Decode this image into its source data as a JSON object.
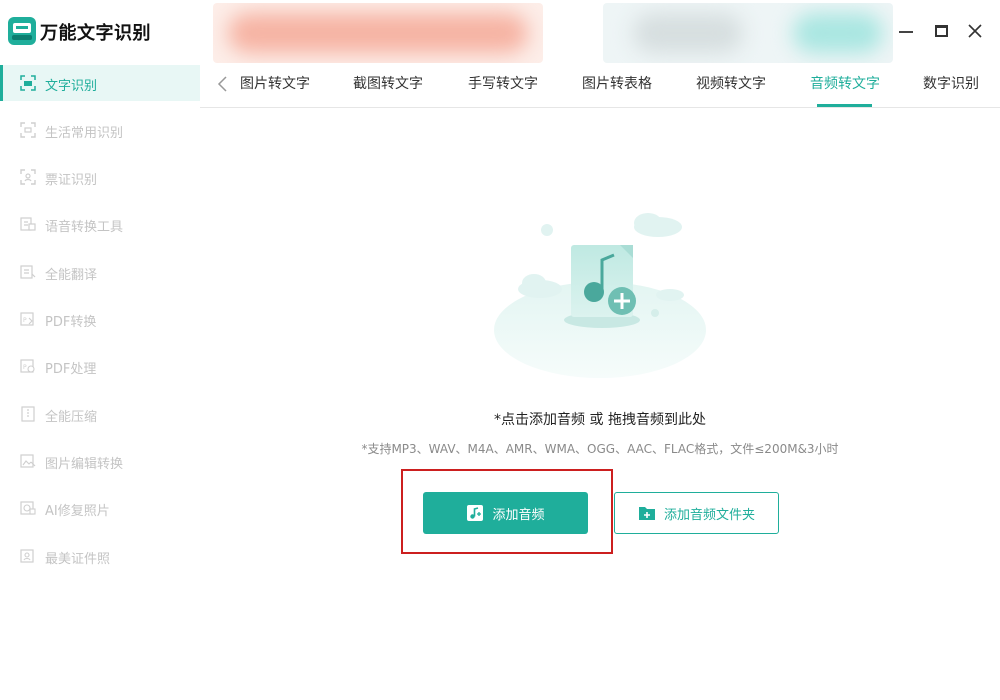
{
  "app": {
    "title": "万能文字识别"
  },
  "window": {
    "min_icon": "minimize-icon",
    "max_icon": "maximize-icon",
    "close_icon": "close-icon"
  },
  "sidebar": {
    "items": [
      {
        "label": "文字识别",
        "icon": "text-scan-icon",
        "active": true
      },
      {
        "label": "生活常用识别",
        "icon": "scan-frame-icon"
      },
      {
        "label": "票证识别",
        "icon": "id-scan-icon"
      },
      {
        "label": "语音转换工具",
        "icon": "voice-convert-icon"
      },
      {
        "label": "全能翻译",
        "icon": "translate-icon"
      },
      {
        "label": "PDF转换",
        "icon": "pdf-convert-icon"
      },
      {
        "label": "PDF处理",
        "icon": "pdf-process-icon"
      },
      {
        "label": "全能压缩",
        "icon": "compress-icon"
      },
      {
        "label": "图片编辑转换",
        "icon": "image-edit-icon"
      },
      {
        "label": "AI修复照片",
        "icon": "ai-photo-icon"
      },
      {
        "label": "最美证件照",
        "icon": "id-photo-icon"
      }
    ]
  },
  "tabs": {
    "back_icon": "chevron-left-icon",
    "items": [
      {
        "label": "图片转文字"
      },
      {
        "label": "截图转文字"
      },
      {
        "label": "手写转文字"
      },
      {
        "label": "图片转表格"
      },
      {
        "label": "视频转文字"
      },
      {
        "label": "音频转文字",
        "active": true
      },
      {
        "label": "数字识别"
      }
    ]
  },
  "main": {
    "illustration_icon": "audio-file-add-icon",
    "hint": "*点击添加音频 或 拖拽音频到此处",
    "support": "*支持MP3、WAV、M4A、AMR、WMA、OGG、AAC、FLAC格式，文件≤200M&3小时",
    "add_audio_label": "添加音频",
    "add_folder_label": "添加音频文件夹"
  },
  "colors": {
    "accent": "#1fae9b",
    "highlight": "#cc1f1f",
    "muted": "#c4c4c4"
  }
}
